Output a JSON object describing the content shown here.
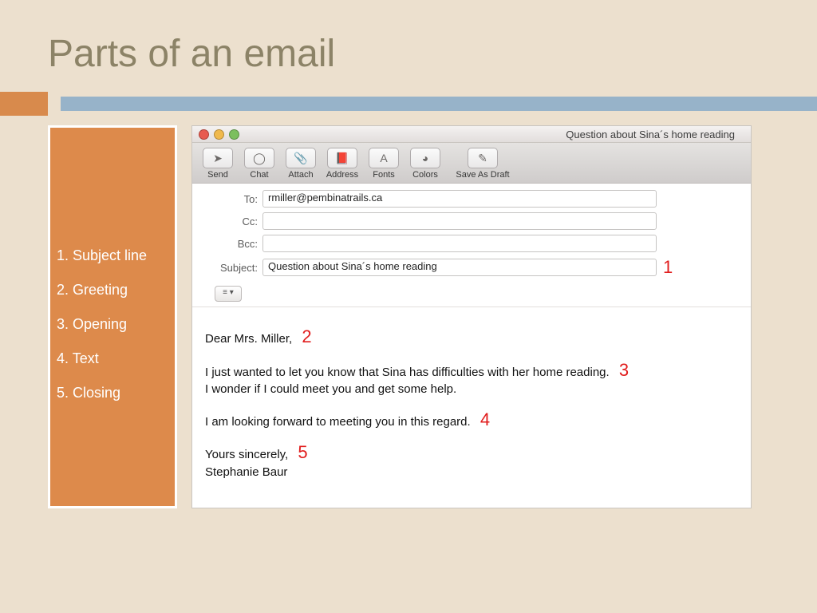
{
  "slide": {
    "title": "Parts of an email"
  },
  "sidebar": {
    "items": [
      "1. Subject line",
      "2. Greeting",
      "3. Opening",
      "4. Text",
      "5. Closing"
    ]
  },
  "mail": {
    "window_title": "Question about Sina´s home reading",
    "toolbar": {
      "send": "Send",
      "chat": "Chat",
      "attach": "Attach",
      "address": "Address",
      "fonts": "Fonts",
      "colors": "Colors",
      "save_draft": "Save As Draft"
    },
    "headers": {
      "to_label": "To:",
      "to_value": "rmiller@pembinatrails.ca",
      "cc_label": "Cc:",
      "cc_value": "",
      "bcc_label": "Bcc:",
      "bcc_value": "",
      "subject_label": "Subject:",
      "subject_value": "Question about Sina´s home reading",
      "options_btn": "≡ ▾"
    },
    "body": {
      "greeting": "Dear Mrs. Miller,",
      "opening_line1": "I just wanted to let you know that Sina has difficulties with her home reading.",
      "opening_line2": "I wonder if I could meet you and get some help.",
      "text": "I am looking forward to meeting you in this regard.",
      "closing1": "Yours sincerely,",
      "closing2": "Stephanie Baur"
    },
    "annotations": {
      "a1": "1",
      "a2": "2",
      "a3": "3",
      "a4": "4",
      "a5": "5"
    }
  },
  "colors": {
    "slide_bg": "#ece0ce",
    "sidebar_bg": "#dd8a4b",
    "accent_blue": "#97b3c9",
    "annotation_red": "#e11d1d"
  }
}
